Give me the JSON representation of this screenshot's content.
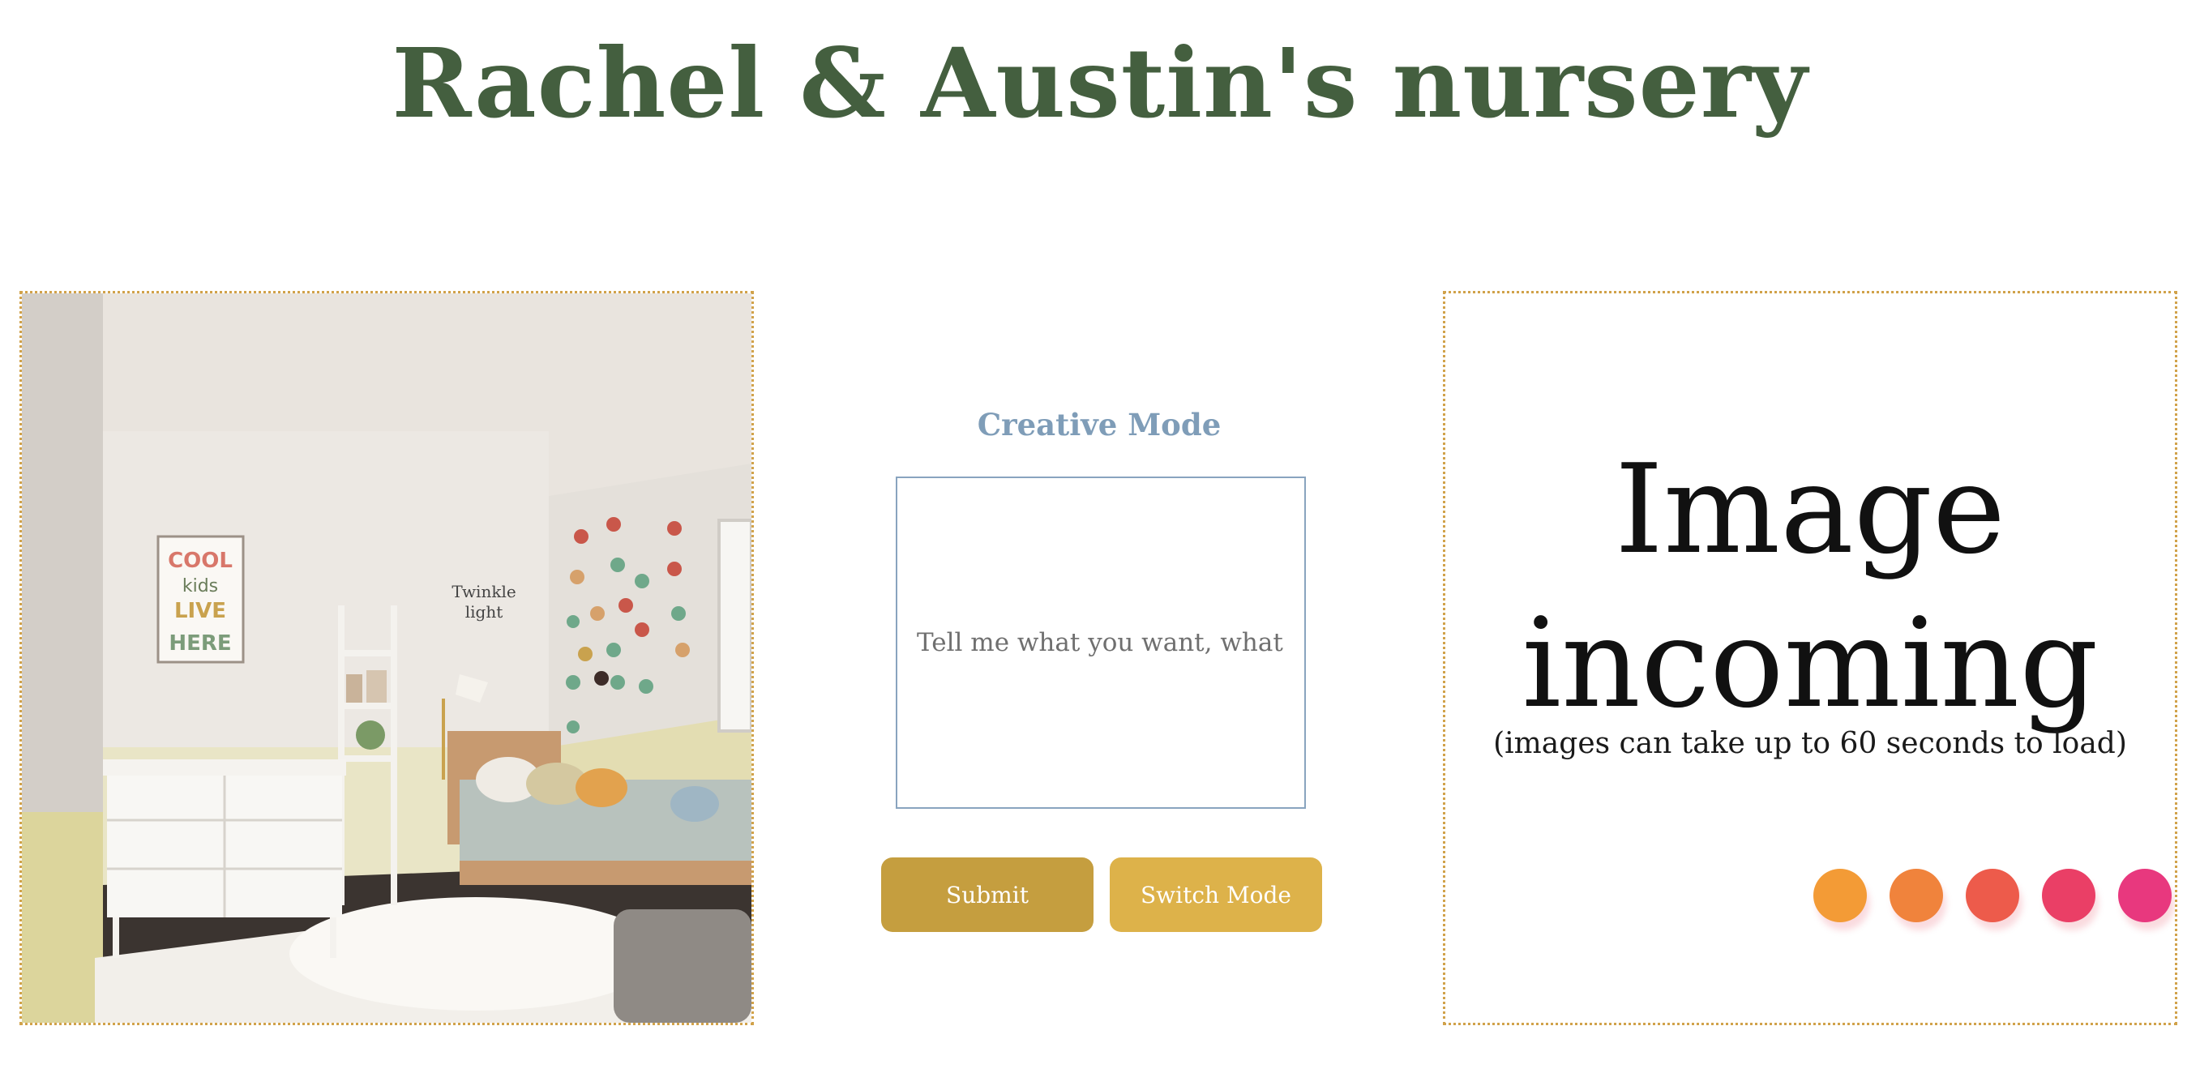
{
  "header": {
    "title": "Rachel & Austin's nursery"
  },
  "controls": {
    "mode_label": "Creative Mode",
    "prompt_placeholder": "Tell me what you want, what yo",
    "submit_label": "Submit",
    "switch_label": "Switch Mode"
  },
  "result": {
    "status_title": "Image incoming",
    "status_note": "(images can take up to 60 seconds to load)",
    "loading_dot_colors": [
      "#f39b36",
      "#f0833c",
      "#ed5b4b",
      "#ea3f66",
      "#e8387e"
    ]
  },
  "colors": {
    "title": "#445f3f",
    "mode_label": "#7f9db8",
    "submit_button": "#c59e3f",
    "switch_button": "#ddb24a",
    "panel_border": "#d1a24a"
  }
}
